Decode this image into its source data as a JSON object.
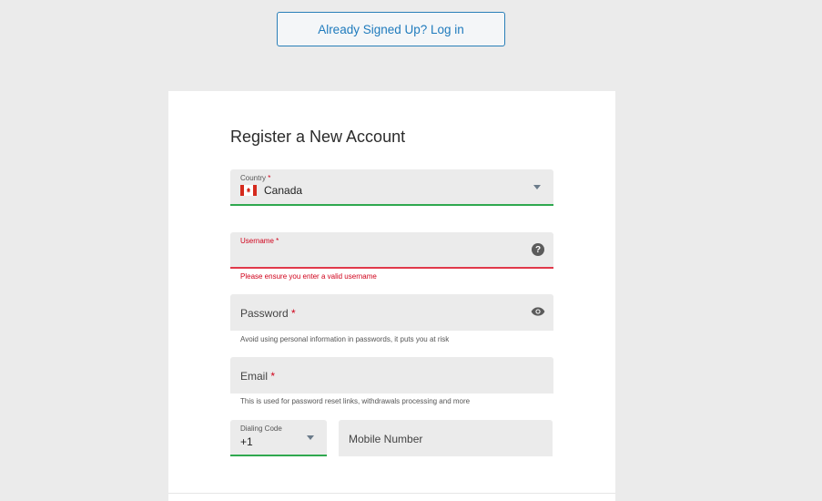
{
  "header": {
    "login_button": "Already Signed Up? Log in"
  },
  "form": {
    "title": "Register a New Account",
    "required_marker": "*",
    "country": {
      "label": "Country",
      "value": "Canada",
      "flag_icon": "canada-flag-icon"
    },
    "username": {
      "label": "Username",
      "error": "Please ensure you enter a valid username",
      "icon": "help-icon"
    },
    "password": {
      "placeholder": "Password",
      "help": "Avoid using personal information in passwords, it puts you at risk",
      "icon": "eye-icon"
    },
    "email": {
      "placeholder": "Email",
      "help": "This is used for password reset links, withdrawals processing and more"
    },
    "dialing_code": {
      "label": "Dialing Code",
      "value": "+1"
    },
    "mobile": {
      "placeholder": "Mobile Number"
    }
  },
  "colors": {
    "accent_blue": "#1f7bbd",
    "success_green": "#2fa84f",
    "error_red": "#d0021b"
  }
}
